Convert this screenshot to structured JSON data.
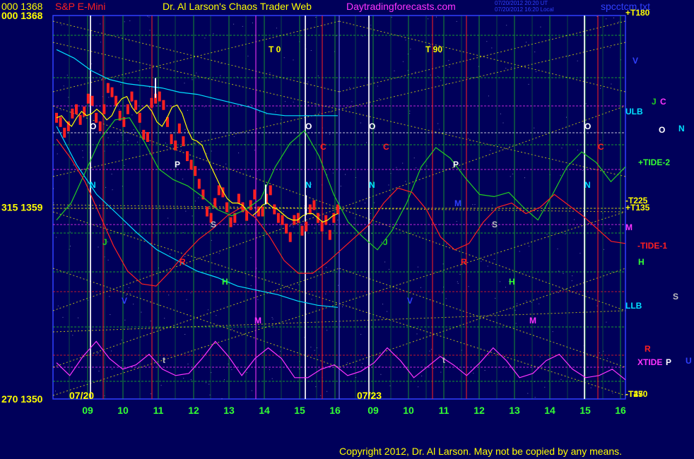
{
  "header": {
    "price_code": "000  1368",
    "symbol": "S&P E-Mini",
    "title": "Dr. Al Larson's Chaos Trader Web",
    "site": "Daytradingforecasts.com",
    "stamp_1": "07/20/2012 20:20 UT",
    "stamp_2": "07/20/2012 16:20 Local",
    "file": "spcctcm.txt"
  },
  "colors": {
    "background": "#00005a",
    "price_candles": "#ff2020",
    "yellow_text": "#ffff00",
    "x_label_green": "#33ff33",
    "cyan": "#00e0ff",
    "green": "#22cc22",
    "magenta": "#ff33ff",
    "red": "#ff2020",
    "blue": "#3040ff"
  },
  "footer": {
    "copyright": "Copyright 2012, Dr. Al Larson. May not be copied by any means."
  },
  "chart_data": {
    "type": "line",
    "y_axis": {
      "ylim": [
        1350,
        1368
      ],
      "left_labels": [
        {
          "text": "000  1368",
          "value": 1368
        },
        {
          "text": "315  1359",
          "value": 1359
        },
        {
          "text": "270  1350",
          "value": 1350
        }
      ]
    },
    "x_axis": {
      "tick_labels": [
        "09",
        "10",
        "11",
        "12",
        "13",
        "14",
        "15",
        "16",
        "09",
        "10",
        "11",
        "12",
        "13",
        "14",
        "15",
        "16"
      ],
      "date_labels": [
        "07/20",
        "07/23"
      ]
    },
    "right_labels": [
      {
        "text": "+T180",
        "color": "#ffff00"
      },
      {
        "text": "V",
        "color": "#3040ff"
      },
      {
        "text": "J",
        "color": "#22cc22"
      },
      {
        "text": "C",
        "color": "#ff33ff"
      },
      {
        "text": "ULB",
        "color": "#00e0ff"
      },
      {
        "text": "O",
        "color": "#ffffff"
      },
      {
        "text": "N",
        "color": "#00e0ff"
      },
      {
        "text": "+TIDE-2",
        "color": "#33ff33"
      },
      {
        "text": "-T225",
        "color": "#ffff00"
      },
      {
        "text": "+T135",
        "color": "#ffff00"
      },
      {
        "text": "M",
        "color": "#ff33ff"
      },
      {
        "text": "-TIDE-1",
        "color": "#ff2020"
      },
      {
        "text": "H",
        "color": "#33ff33"
      },
      {
        "text": "LLB",
        "color": "#00e0ff"
      },
      {
        "text": "S",
        "color": "#c0c0c0"
      },
      {
        "text": "R",
        "color": "#ff2020"
      },
      {
        "text": "XTIDE",
        "color": "#ff33ff"
      },
      {
        "text": "P",
        "color": "#ffffff"
      },
      {
        "text": "U",
        "color": "#3040ff"
      },
      {
        "text": "-T270",
        "color": "#ffff00"
      },
      {
        "text": "-T45",
        "color": "#ffff00"
      }
    ],
    "t_markers": [
      "T  0",
      "T  90"
    ],
    "plot_letters": [
      {
        "text": "O",
        "color": "#ffffff"
      },
      {
        "text": "O",
        "color": "#ffffff"
      },
      {
        "text": "O",
        "color": "#ffffff"
      },
      {
        "text": "O",
        "color": "#ffffff"
      },
      {
        "text": "N",
        "color": "#00e0ff"
      },
      {
        "text": "N",
        "color": "#00e0ff"
      },
      {
        "text": "N",
        "color": "#00e0ff"
      },
      {
        "text": "N",
        "color": "#00e0ff"
      },
      {
        "text": "C",
        "color": "#ff2020"
      },
      {
        "text": "C",
        "color": "#ff2020"
      },
      {
        "text": "C",
        "color": "#ff2020"
      },
      {
        "text": "P",
        "color": "#ffffff"
      },
      {
        "text": "P",
        "color": "#ffffff"
      },
      {
        "text": "S",
        "color": "#c0c0c0"
      },
      {
        "text": "S",
        "color": "#c0c0c0"
      },
      {
        "text": "J",
        "color": "#22cc22"
      },
      {
        "text": "J",
        "color": "#22cc22"
      },
      {
        "text": "R",
        "color": "#ff2020"
      },
      {
        "text": "R",
        "color": "#ff2020"
      },
      {
        "text": "H",
        "color": "#33ff33"
      },
      {
        "text": "H",
        "color": "#33ff33"
      },
      {
        "text": "V",
        "color": "#3040ff"
      },
      {
        "text": "V",
        "color": "#3040ff"
      },
      {
        "text": "M",
        "color": "#ff33ff"
      },
      {
        "text": "M",
        "color": "#ff33ff"
      },
      {
        "text": "M",
        "color": "#3040ff"
      },
      {
        "text": "t",
        "color": "#c0c0c0"
      },
      {
        "text": "t",
        "color": "#c0c0c0"
      }
    ],
    "series": [
      {
        "color": "#ff2020",
        "style": "candles",
        "values": [
          1363.2,
          1363.0,
          1362.5,
          1362.8,
          1363.4,
          1363.6,
          1363.1,
          1363.5,
          1364.1,
          1364.0,
          1363.2,
          1362.8,
          1363.6,
          1364.6,
          1364.4,
          1364.0,
          1363.3,
          1363.0,
          1363.6,
          1364.2,
          1363.8,
          1363.2,
          1362.4,
          1362.3,
          1363.9,
          1364.1,
          1364.2,
          1363.8,
          1363.0,
          1362.2,
          1361.9,
          1362.7,
          1362.1,
          1361.4,
          1361.0,
          1360.7,
          1360.1,
          1359.6,
          1358.8,
          1358.5,
          1359.2,
          1359.8,
          1359.7,
          1359.0,
          1358.3,
          1358.5,
          1359.4,
          1359.0,
          1358.6,
          1359.1,
          1359.6,
          1358.8,
          1358.8,
          1359.4,
          1359.8,
          1358.9,
          1358.5,
          1358.4,
          1358.0,
          1357.6,
          1358.4,
          1358.5,
          1357.9,
          1358.1,
          1358.9,
          1359.1,
          1358.5,
          1358.1,
          1358.4,
          1357.7,
          1358.5,
          1358.9
        ]
      },
      {
        "color": "#ffff00",
        "style": "fast-average",
        "values": [
          1363.2,
          1363.3,
          1363.0,
          1362.8,
          1363.2,
          1363.5,
          1363.3,
          1363.4,
          1363.6,
          1363.4,
          1363.1,
          1363.3,
          1363.8,
          1364.1,
          1364.2,
          1363.7,
          1363.4,
          1363.6,
          1363.8,
          1363.5,
          1363.0,
          1362.8,
          1363.2,
          1363.7,
          1363.8,
          1363.4,
          1362.7,
          1362.2,
          1362.1,
          1361.9,
          1361.3,
          1360.8,
          1360.3,
          1359.8,
          1359.4,
          1359.2,
          1359.2,
          1359.1,
          1358.8,
          1358.6,
          1358.8,
          1359.1,
          1359.2,
          1359.0,
          1358.9,
          1358.7,
          1358.5,
          1358.4,
          1358.4,
          1358.6,
          1358.7,
          1358.7,
          1358.5,
          1358.3,
          1358.4,
          1358.6,
          1358.7
        ]
      },
      {
        "color": "#00e0ff",
        "style": "band-upper",
        "values": [
          1366.4,
          1366.0,
          1365.4,
          1365.0,
          1364.8,
          1364.7,
          1364.6,
          1364.4,
          1364.3,
          1364.1,
          1363.9,
          1363.7,
          1363.4,
          1363.3,
          1363.3,
          1363.3,
          1363.3
        ]
      },
      {
        "color": "#00e0ff",
        "style": "band-lower",
        "values": [
          1362.8,
          1361.0,
          1359.6,
          1358.7,
          1357.8,
          1357.0,
          1356.5,
          1356.0,
          1355.7,
          1355.3,
          1355.1,
          1354.9,
          1354.6,
          1354.4,
          1354.3
        ]
      },
      {
        "color": "#22cc22",
        "style": "tide-2",
        "values": [
          1358.4,
          1359.2,
          1360.7,
          1362.2,
          1363.1,
          1363.2,
          1362.1,
          1360.8,
          1360.3,
          1360.0,
          1359.5,
          1358.9,
          1358.6,
          1358.9,
          1359.4,
          1360.9,
          1362.0,
          1362.6,
          1361.4,
          1359.6,
          1358.3,
          1357.6,
          1357.0,
          1357.9,
          1359.2,
          1360.9,
          1361.8,
          1361.3,
          1360.4,
          1359.6,
          1359.5,
          1359.7,
          1359.0,
          1358.4,
          1359.6,
          1360.9,
          1361.6,
          1361.1,
          1360.2,
          1360.9
        ]
      },
      {
        "color": "#ff2020",
        "style": "tide-1",
        "values": [
          1362.2,
          1361.3,
          1360.2,
          1358.7,
          1357.2,
          1356.0,
          1355.4,
          1355.3,
          1356.0,
          1356.8,
          1357.5,
          1358.0,
          1358.6,
          1359.0,
          1358.5,
          1357.6,
          1356.5,
          1355.9,
          1355.9,
          1356.4,
          1357.0,
          1357.6,
          1358.2,
          1359.2,
          1359.9,
          1359.7,
          1358.9,
          1357.6,
          1357.0,
          1357.3,
          1358.3,
          1359.0,
          1359.2,
          1358.7,
          1359.0,
          1359.6,
          1359.1,
          1358.6,
          1358.0,
          1357.4,
          1357.3
        ]
      },
      {
        "color": "#ff33ff",
        "style": "xtide",
        "values": [
          1351.7,
          1351.1,
          1352.0,
          1352.7,
          1351.9,
          1351.4,
          1351.6,
          1352.1,
          1351.4,
          1351.1,
          1351.2,
          1351.9,
          1352.7,
          1352.0,
          1351.1,
          1351.9,
          1352.4,
          1351.9,
          1351.0,
          1351.0,
          1351.4,
          1351.6,
          1351.1,
          1351.3,
          1351.7,
          1352.4,
          1351.8,
          1351.0,
          1351.5,
          1352.0,
          1351.6,
          1351.1,
          1351.7,
          1352.4,
          1351.8,
          1351.0,
          1351.2,
          1351.8,
          1352.1,
          1351.4,
          1351.0,
          1351.1,
          1351.4,
          1350.9
        ]
      }
    ]
  }
}
